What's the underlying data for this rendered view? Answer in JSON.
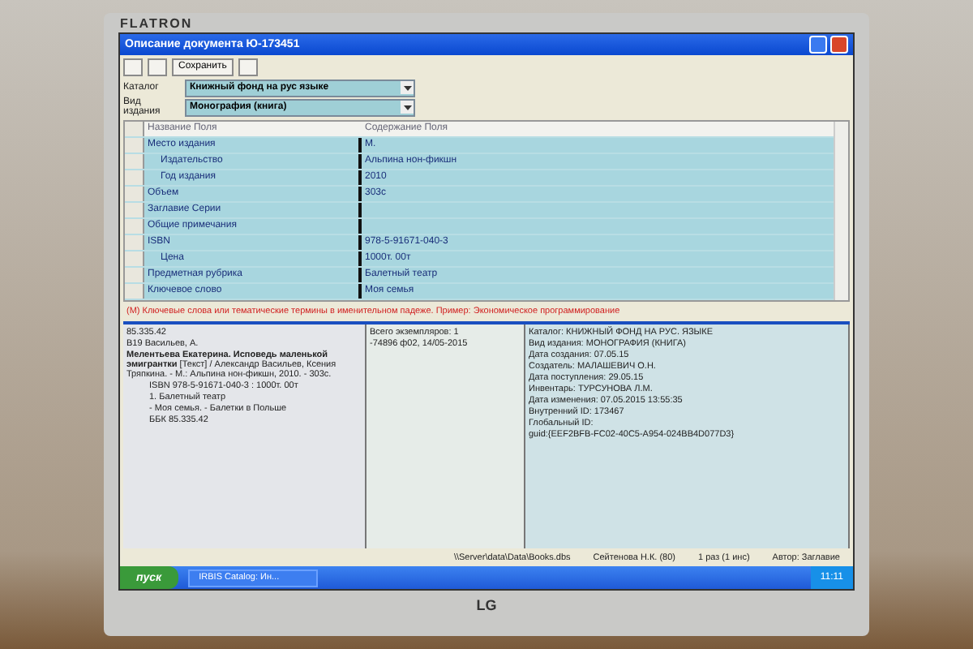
{
  "monitor": {
    "brand": "FLATRON",
    "logo": "LG"
  },
  "window": {
    "title": "Описание документа Ю-173451"
  },
  "toolbar": {
    "save_label": "Сохранить"
  },
  "form": [
    {
      "label": "Каталог",
      "value": "Книжный фонд на рус языке"
    },
    {
      "label": "Вид издания",
      "value": "Монография (книга)"
    }
  ],
  "grid": {
    "columns": [
      "Название Поля",
      "Содержание Поля"
    ],
    "rows": [
      {
        "name": "Место издания",
        "value": "М.",
        "children": [
          {
            "name": "Издательство",
            "value": "Альпина нон-фикшн"
          },
          {
            "name": "Год издания",
            "value": "2010"
          }
        ]
      },
      {
        "name": "Объем",
        "value": "303с"
      },
      {
        "name": "Заглавие Серии"
      },
      {
        "name": "Общие примечания"
      },
      {
        "name": "ISBN",
        "value": "978-5-91671-040-3",
        "children": [
          {
            "name": "Цена",
            "value": "1000т. 00т"
          }
        ]
      },
      {
        "name": "Предметная рубрика",
        "value": "Балетный театр"
      },
      {
        "name": "Ключевое слово",
        "value": "Моя семья"
      }
    ]
  },
  "hint": "(M) Ключевые слова или тематические термины в именительном падеже. Пример: Экономическое программирование",
  "card": [
    "85.335.42",
    "В19 Васильев, А.",
    "**Мелентьева Екатерина. Исповедь маленькой эмигрантки** [Текст] / Александр Васильев, Ксения Тряпкина. - М.: Альпина нон-фикшн, 2010. - 303с.",
    "ISBN 978-5-91671-040-3 : 1000т. 00т",
    "1. Балетный театр",
    "- Моя семья. - Балетки в Польше",
    "ББК 85.335.42"
  ],
  "copies": {
    "total": "Всего экземпляров: 1",
    "items": [
      "-74896 ф02, 14/05-2015"
    ]
  },
  "info": [
    "Каталог: КНИЖНЫЙ ФОНД НА РУС. ЯЗЫКЕ",
    "Вид издания: МОНОГРАФИЯ (КНИГА)",
    "Дата создания: 07.05.15",
    "Создатель: МАЛАШЕВИЧ О.Н.",
    "Дата поступления: 29.05.15",
    "Инвентарь: ТУРСУНОВА Л.М.",
    "Дата изменения: 07.05.2015 13:55:35",
    "Внутренний ID: 173467",
    "Глобальный ID:",
    "guid:{EEF2BFB-FC02-40C5-A954-024BB4D077D3}"
  ],
  "status_bar": [
    "\\\\Server\\data\\Data\\Books.dbs",
    "Сейтенова Н.К. (80)",
    "1 раз (1 инс)",
    "Автор: Заглавие"
  ],
  "taskbar": {
    "start": "пуск",
    "tasks": [
      "IRBIS Catalog: Ин..."
    ],
    "clock": "11:11"
  }
}
